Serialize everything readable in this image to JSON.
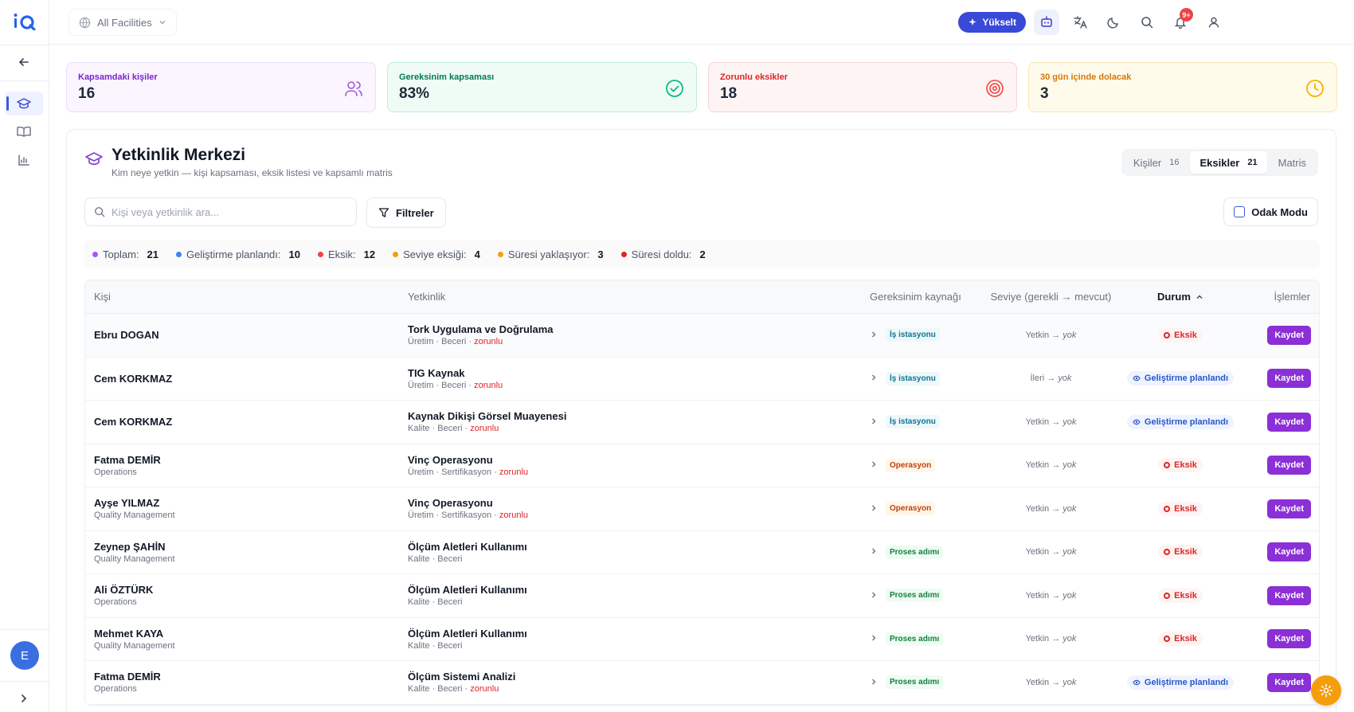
{
  "app": {
    "logo_text": "iQ"
  },
  "header": {
    "facility_label": "All Facilities",
    "upgrade_label": "Yükselt",
    "notification_count": "9+"
  },
  "sidebar": {
    "avatar_initial": "E"
  },
  "kpis": [
    {
      "label": "Kapsamdaki kişiler",
      "value": "16",
      "color": "#7e22ce",
      "icon": "users-icon"
    },
    {
      "label": "Gereksinim kapsaması",
      "value": "83%",
      "color": "#047857",
      "icon": "check-circle-icon"
    },
    {
      "label": "Zorunlu eksikler",
      "value": "18",
      "color": "#dc2626",
      "icon": "target-icon"
    },
    {
      "label": "30 gün içinde dolacak",
      "value": "3",
      "color": "#d97706",
      "icon": "clock-icon"
    }
  ],
  "main": {
    "title": "Yetkinlik Merkezi",
    "subtitle": "Kim neye yetkin — kişi kapsaması, eksik listesi ve kapsamlı matris",
    "tabs": [
      {
        "label": "Kişiler",
        "count": "16"
      },
      {
        "label": "Eksikler",
        "count": "21"
      },
      {
        "label": "Matris"
      }
    ],
    "search_placeholder": "Kişi veya yetkinlik ara...",
    "filters_label": "Filtreler",
    "focus_label": "Odak Modu"
  },
  "stats": [
    {
      "label": "Toplam:",
      "value": "21",
      "color": "#a855f7"
    },
    {
      "label": "Geliştirme planlandı:",
      "value": "10",
      "color": "#3b82f6"
    },
    {
      "label": "Eksik:",
      "value": "12",
      "color": "#ef4444"
    },
    {
      "label": "Seviye eksiği:",
      "value": "4",
      "color": "#f59e0b"
    },
    {
      "label": "Süresi yaklaşıyor:",
      "value": "3",
      "color": "#f59e0b"
    },
    {
      "label": "Süresi doldu:",
      "value": "2",
      "color": "#dc2626"
    }
  ],
  "table": {
    "headers": {
      "person": "Kişi",
      "competency": "Yetkinlik",
      "source": "Gereksinim kaynağı",
      "level": "Seviye (gerekli → mevcut)",
      "status": "Durum",
      "actions": "İşlemler"
    },
    "save_label": "Kaydet",
    "rows": [
      {
        "person": "Ebru DOGAN",
        "dept": "",
        "competency": "Tork Uygulama ve Doğrulama",
        "meta": "Üretim · Beceri · ",
        "required": "zorunlu",
        "source": "İş istasyonu",
        "source_type": "station",
        "level_req": "Yetkin",
        "level_cur": "yok",
        "status": "Eksik",
        "status_type": "missing"
      },
      {
        "person": "Cem KORKMAZ",
        "dept": "",
        "competency": "TIG Kaynak",
        "meta": "Üretim · Beceri · ",
        "required": "zorunlu",
        "source": "İş istasyonu",
        "source_type": "station",
        "level_req": "İleri",
        "level_cur": "yok",
        "status": "Geliştirme planlandı",
        "status_type": "planned"
      },
      {
        "person": "Cem KORKMAZ",
        "dept": "",
        "competency": "Kaynak Dikişi Görsel Muayenesi",
        "meta": "Kalite · Beceri · ",
        "required": "zorunlu",
        "source": "İş istasyonu",
        "source_type": "station",
        "level_req": "Yetkin",
        "level_cur": "yok",
        "status": "Geliştirme planlandı",
        "status_type": "planned"
      },
      {
        "person": "Fatma DEMİR",
        "dept": "Operations",
        "competency": "Vinç Operasyonu",
        "meta": "Üretim · Sertifikasyon · ",
        "required": "zorunlu",
        "source": "Operasyon",
        "source_type": "op",
        "level_req": "Yetkin",
        "level_cur": "yok",
        "status": "Eksik",
        "status_type": "missing"
      },
      {
        "person": "Ayşe YILMAZ",
        "dept": "Quality Management",
        "competency": "Vinç Operasyonu",
        "meta": "Üretim · Sertifikasyon · ",
        "required": "zorunlu",
        "source": "Operasyon",
        "source_type": "op",
        "level_req": "Yetkin",
        "level_cur": "yok",
        "status": "Eksik",
        "status_type": "missing"
      },
      {
        "person": "Zeynep ŞAHİN",
        "dept": "Quality Management",
        "competency": "Ölçüm Aletleri Kullanımı",
        "meta": "Kalite · Beceri",
        "required": "",
        "source": "Proses adımı",
        "source_type": "proc",
        "level_req": "Yetkin",
        "level_cur": "yok",
        "status": "Eksik",
        "status_type": "missing"
      },
      {
        "person": "Ali ÖZTÜRK",
        "dept": "Operations",
        "competency": "Ölçüm Aletleri Kullanımı",
        "meta": "Kalite · Beceri",
        "required": "",
        "source": "Proses adımı",
        "source_type": "proc",
        "level_req": "Yetkin",
        "level_cur": "yok",
        "status": "Eksik",
        "status_type": "missing"
      },
      {
        "person": "Mehmet KAYA",
        "dept": "Quality Management",
        "competency": "Ölçüm Aletleri Kullanımı",
        "meta": "Kalite · Beceri",
        "required": "",
        "source": "Proses adımı",
        "source_type": "proc",
        "level_req": "Yetkin",
        "level_cur": "yok",
        "status": "Eksik",
        "status_type": "missing"
      },
      {
        "person": "Fatma DEMİR",
        "dept": "Operations",
        "competency": "Ölçüm Sistemi Analizi",
        "meta": "Kalite · Beceri · ",
        "required": "zorunlu",
        "source": "Proses adımı",
        "source_type": "proc",
        "level_req": "Yetkin",
        "level_cur": "yok",
        "status": "Geliştirme planlandı",
        "status_type": "planned"
      }
    ]
  }
}
